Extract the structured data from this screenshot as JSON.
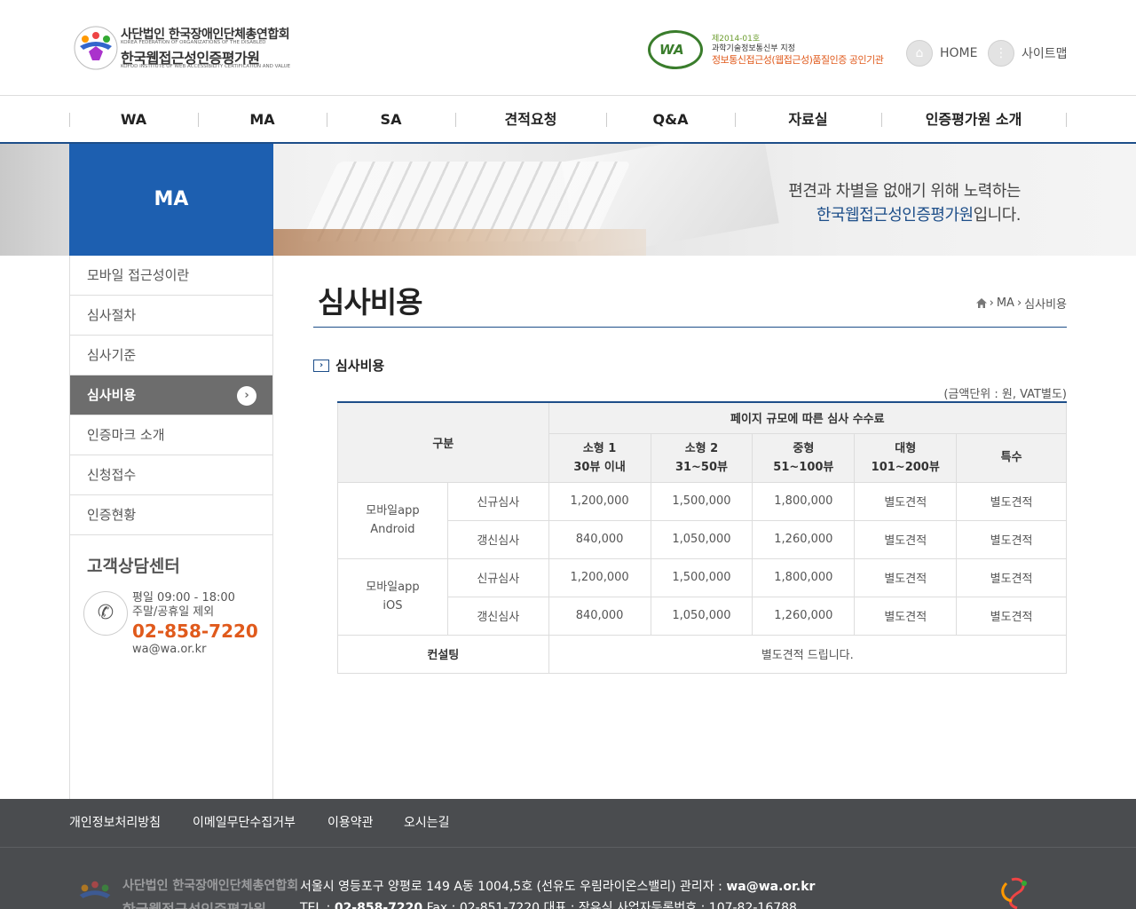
{
  "header": {
    "logo": {
      "line1": "사단법인 한국장애인단체총연합회",
      "line1_en": "KOREA FEDERATION OF ORGANIZATIONS OF THE DISABLED",
      "line2": "한국웹접근성인증평가원",
      "line2_en": "KOFOD INSTITUTE OF WEB ACCESSIBILITY CERTIFICATION AND VALUE"
    },
    "cert": {
      "mark": "WA",
      "line1": "제2014-01호",
      "line2": "과학기술정보통신부 지정",
      "line3": "정보통신접근성(웹접근성)품질인증 공인기관"
    },
    "home_label": "HOME",
    "sitemap_label": "사이트맵"
  },
  "gnb": [
    "WA",
    "MA",
    "SA",
    "견적요청",
    "Q&A",
    "자료실",
    "인증평가원 소개"
  ],
  "visual": {
    "section": "MA",
    "slogan_line1": "편견과 차별을 없애기 위해 노력하는",
    "slogan_line2_highlight": "한국웹접근성인증평가원",
    "slogan_line2_rest": "입니다."
  },
  "sidebar": {
    "items": [
      {
        "label": "모바일 접근성이란",
        "active": false
      },
      {
        "label": "심사절차",
        "active": false
      },
      {
        "label": "심사기준",
        "active": false
      },
      {
        "label": "심사비용",
        "active": true
      },
      {
        "label": "인증마크 소개",
        "active": false
      },
      {
        "label": "신청접수",
        "active": false
      },
      {
        "label": "인증현황",
        "active": false
      }
    ],
    "cs": {
      "title": "고객상담센터",
      "hours1": "평일 09:00 - 18:00",
      "hours2": "주말/공휴일 제외",
      "phone": "02-858-7220",
      "email": "wa@wa.or.kr"
    }
  },
  "content": {
    "title": "심사비용",
    "breadcrumb": [
      "MA",
      "심사비용"
    ],
    "section_title": "심사비용",
    "unit": "(금액단위 : 원, VAT별도)",
    "table": {
      "head_category": "구분",
      "head_group": "페이지 규모에 따른 심사 수수료",
      "columns": [
        {
          "line1": "소형 1",
          "line2": "30뷰 이내"
        },
        {
          "line1": "소형 2",
          "line2": "31~50뷰"
        },
        {
          "line1": "중형",
          "line2": "51~100뷰"
        },
        {
          "line1": "대형",
          "line2": "101~200뷰"
        },
        {
          "line1": "특수",
          "line2": ""
        }
      ],
      "groups": [
        {
          "name1": "모바일app",
          "name2": "Android",
          "rows": [
            {
              "type": "신규심사",
              "values": [
                "1,200,000",
                "1,500,000",
                "1,800,000",
                "별도견적",
                "별도견적"
              ]
            },
            {
              "type": "갱신심사",
              "values": [
                "840,000",
                "1,050,000",
                "1,260,000",
                "별도견적",
                "별도견적"
              ]
            }
          ]
        },
        {
          "name1": "모바일app",
          "name2": "iOS",
          "rows": [
            {
              "type": "신규심사",
              "values": [
                "1,200,000",
                "1,500,000",
                "1,800,000",
                "별도견적",
                "별도견적"
              ]
            },
            {
              "type": "갱신심사",
              "values": [
                "840,000",
                "1,050,000",
                "1,260,000",
                "별도견적",
                "별도견적"
              ]
            }
          ]
        }
      ],
      "consulting_label": "컨설팅",
      "consulting_value": "별도견적 드립니다."
    }
  },
  "footer": {
    "links": [
      "개인정보처리방침",
      "이메일무단수집거부",
      "이용약관",
      "오시는길"
    ],
    "address_line1": "서울시 영등포구 양평로 149 A동 1004,5호 (선유도 우림라이온스밸리) 관리자 : ",
    "admin_email": "wa@wa.or.kr",
    "address_line2_prefix": "TEL : ",
    "tel": "02-858-7220",
    "address_line2_rest": " Fax : 02-851-7220 대표 : 장유식 사업자등록번호 : 107-82-16788",
    "logo_line1": "사단법인 한국장애인단체총연합회",
    "logo_line2": "한국웹접근성인증평가원"
  },
  "colors": {
    "brand_blue": "#1d4e89",
    "accent_orange": "#e05a1c",
    "footer_bg": "#4a4c4f"
  }
}
